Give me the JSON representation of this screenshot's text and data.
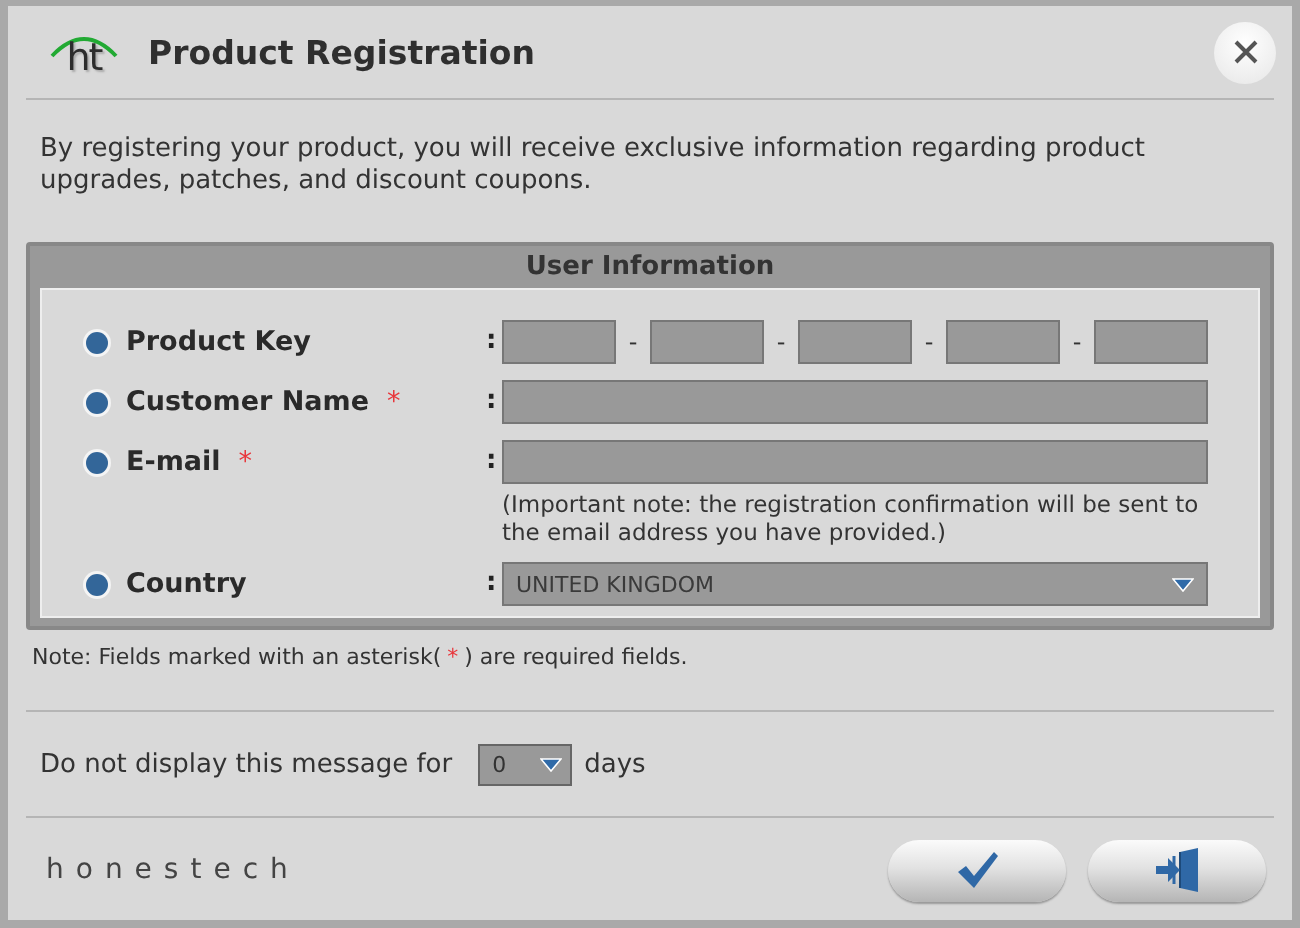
{
  "window": {
    "logo": "ht",
    "title": "Product Registration"
  },
  "intro": "By registering your product, you will receive exclusive information regarding product upgrades, patches, and discount coupons.",
  "section": {
    "title": "User Information",
    "fields": [
      {
        "kind": "key",
        "label": "Product Key",
        "colon": ":",
        "separators": [
          "-",
          "-",
          "-",
          "-"
        ]
      },
      {
        "kind": "text",
        "label": "Customer Name",
        "required_mark": "*",
        "colon": ":"
      },
      {
        "kind": "text",
        "label": "E-mail",
        "required_mark": "*",
        "colon": ":",
        "hint": "(Important note: the registration confirmation will be sent to the email address you have provided.)"
      },
      {
        "kind": "select",
        "label": "Country",
        "colon": ":",
        "value": "UNITED KINGDOM"
      }
    ]
  },
  "note": {
    "before": "Note: Fields marked with an asterisk(",
    "mark": "*",
    "after": ") are required fields."
  },
  "reminder": {
    "before": "Do not display this message for",
    "value": "0",
    "after": "days"
  },
  "footer": {
    "brand": "honestech",
    "buttons": [
      {
        "kind": "confirm"
      },
      {
        "kind": "exit"
      }
    ]
  }
}
